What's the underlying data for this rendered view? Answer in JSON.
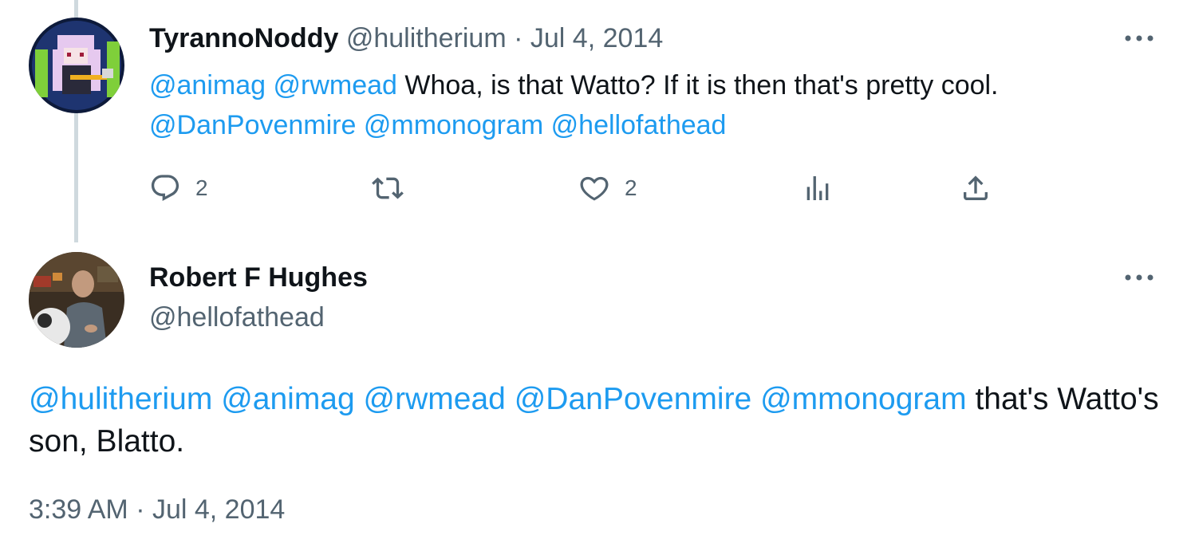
{
  "tweet1": {
    "author_name": "TyrannoNoddy",
    "author_handle": "@hulitherium",
    "separator": "·",
    "date": "Jul 4, 2014",
    "mentions_line1": [
      "@animag",
      "@rwmead"
    ],
    "text": "Whoa, is that Watto? If it is then that's pretty cool.",
    "mentions_line2": [
      "@DanPovenmire",
      "@mmonogram",
      "@hellofathead"
    ],
    "reply_count": "2",
    "like_count": "2"
  },
  "tweet2": {
    "author_name": "Robert F Hughes",
    "author_handle": "@hellofathead",
    "mentions": [
      "@hulitherium",
      "@animag",
      "@rwmead",
      "@DanPovenmire",
      "@mmonogram"
    ],
    "text_tail": "that's Watto's son, Blatto.",
    "timestamp": "3:39 AM · Jul 4, 2014"
  },
  "icons": {
    "more": "more-horizontal-icon",
    "reply": "reply-icon",
    "retweet": "retweet-icon",
    "like": "heart-icon",
    "views": "analytics-icon",
    "share": "share-icon"
  },
  "colors": {
    "link": "#1d9bf0",
    "text": "#0f1419",
    "muted": "#536471",
    "thread_line": "#cfd9de"
  }
}
